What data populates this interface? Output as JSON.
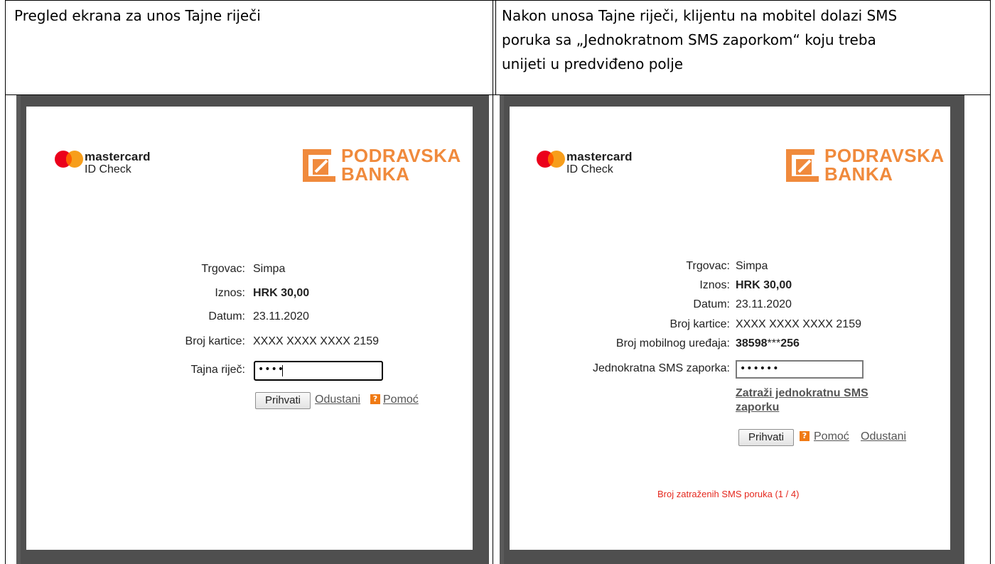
{
  "table": {
    "header_left": "Pregled ekrana za unos Tajne riječi",
    "header_right_lines": [
      "Nakon unosa Tajne riječi, klijentu na mobitel dolazi SMS",
      "poruka sa „Jednokratnom SMS zaporkom“ koju treba",
      "unijeti u predviđeno polje"
    ]
  },
  "brand": {
    "mastercard_name": "mastercard",
    "mastercard_sub": "ID Check",
    "bank_line1": "PODRAVSKA",
    "bank_line2": "BANKA",
    "bank_color": "#f08a3c",
    "mc_red": "#eb001b",
    "mc_orange": "#f79e1b",
    "mc_overlap": "#ff5f00"
  },
  "left_screen": {
    "merchant_label": "Trgovac:",
    "merchant_value": "Simpa",
    "amount_label": "Iznos:",
    "amount_value": "HRK 30,00",
    "date_label": "Datum:",
    "date_value": "23.11.2020",
    "card_label": "Broj kartice:",
    "card_value": "XXXX XXXX XXXX 2159",
    "secret_label": "Tajna riječ:",
    "secret_masked": "••••",
    "accept_button": "Prihvati",
    "cancel_link": "Odustani",
    "help_icon": "?",
    "help_link": "Pomoć"
  },
  "right_screen": {
    "merchant_label": "Trgovac:",
    "merchant_value": "Simpa",
    "amount_label": "Iznos:",
    "amount_value": "HRK 30,00",
    "date_label": "Datum:",
    "date_value": "23.11.2020",
    "card_label": "Broj kartice:",
    "card_value": "XXXX XXXX XXXX 2159",
    "mobile_label": "Broj mobilnog uređaja:",
    "mobile_prefix": "38598",
    "mobile_mask": "***",
    "mobile_suffix": "256",
    "otp_label": "Jednokratna SMS zaporka:",
    "otp_masked": "••••••",
    "request_link_line1": "Zatraži jednokratnu SMS",
    "request_link_line2": "zaporku",
    "accept_button": "Prihvati",
    "help_icon": "?",
    "help_link": "Pomoć",
    "cancel_link": "Odustani",
    "sms_count": "Broj zatraženih SMS poruka (1 / 4)"
  }
}
